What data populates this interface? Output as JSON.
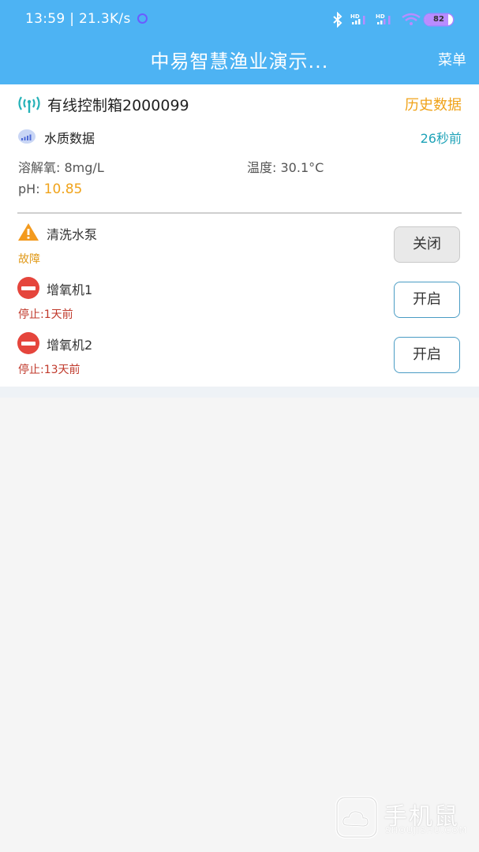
{
  "status_bar": {
    "time": "13:59",
    "speed": "21.3K/s",
    "battery": "82",
    "battery_level": 0.82,
    "icons": [
      "bluetooth-icon",
      "hd-signal-icon",
      "hd-signal-icon",
      "wifi-icon",
      "battery-icon"
    ]
  },
  "app_bar": {
    "title": "中易智慧渔业演示...",
    "menu_label": "菜单"
  },
  "device": {
    "name": "有线控制箱2000099",
    "history_label": "历史数据",
    "icon": "antenna-signal-icon"
  },
  "water_quality": {
    "title": "水质数据",
    "updated": "26秒前",
    "dissolved_oxygen_label": "溶解氧:",
    "dissolved_oxygen_value": "8mg/L",
    "temperature_label": "温度:",
    "temperature_value": "30.1°C",
    "ph_label": "pH:",
    "ph_value": "10.85"
  },
  "equipment": [
    {
      "name": "清洗水泵",
      "status": "故障",
      "button": "关闭",
      "icon": "warning-icon"
    },
    {
      "name": "增氧机1",
      "status": "停止:1天前",
      "button": "开启",
      "icon": "stop-icon"
    },
    {
      "name": "增氧机2",
      "status": "停止:13天前",
      "button": "开启",
      "icon": "stop-icon"
    }
  ],
  "watermark": {
    "text": "手机鼠",
    "subtext": "SHOUJISHU.COM"
  },
  "colors": {
    "app_bar": "#4db3f3",
    "accent_orange": "#f0a31a",
    "accent_teal": "#1fa3b8",
    "stop_red": "#e5453c",
    "status_red": "#c0392b"
  }
}
